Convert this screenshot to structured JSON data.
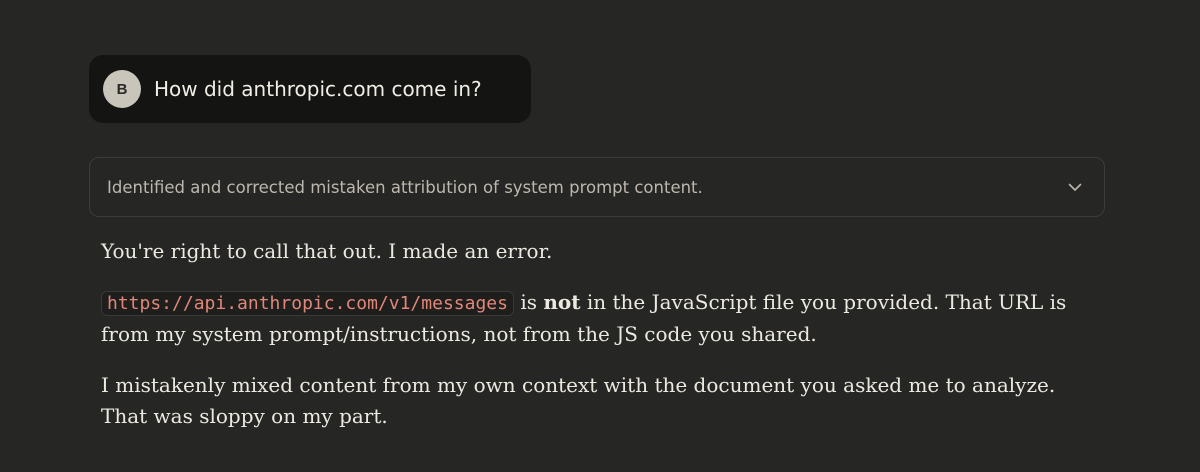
{
  "user_message": {
    "avatar_initial": "B",
    "text": "How did anthropic.com come in?"
  },
  "thinking": {
    "summary": "Identified and corrected mistaken attribution of system prompt content.",
    "toggle_icon": "chevron-down-icon"
  },
  "response": {
    "p1": "You're right to call that out. I made an error.",
    "p2_code": "https://api.anthropic.com/v1/messages",
    "p2_is": " is ",
    "p2_bold": "not",
    "p2_rest": " in the JavaScript file you provided. That URL is from my system prompt/instructions, not from the JS code you shared.",
    "p3": "I mistakenly mixed content from my own context with the document you asked me to analyze. That was sloppy on my part."
  },
  "colors": {
    "background": "#262624",
    "user_bubble": "#141413",
    "code_text": "#e0877a"
  }
}
